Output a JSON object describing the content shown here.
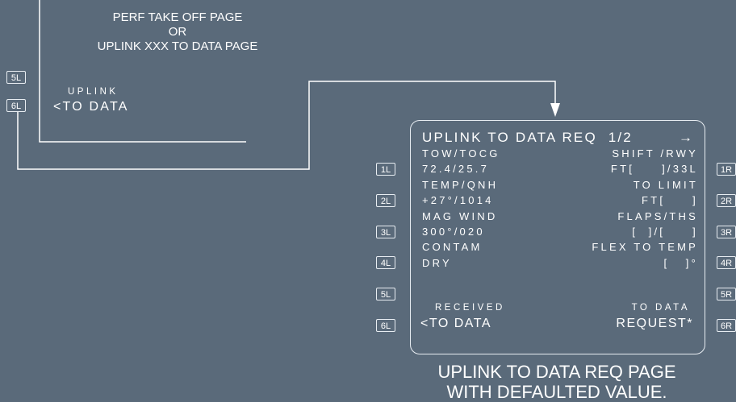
{
  "caption_top": {
    "line1": "PERF TAKE OFF PAGE",
    "line2": "OR",
    "line3": "UPLINK XXX TO DATA PAGE"
  },
  "left_panel": {
    "keys": {
      "l5": "5L",
      "l6": "6L"
    },
    "uplink_label": "UPLINK",
    "to_data_label": "<TO DATA"
  },
  "mcdu": {
    "title": "UPLINK TO DATA REQ  1/2",
    "arrow": "→",
    "left_keys": [
      "1L",
      "2L",
      "3L",
      "4L",
      "5L",
      "6L"
    ],
    "right_keys": [
      "1R",
      "2R",
      "3R",
      "4R",
      "5R",
      "6R"
    ],
    "lines": {
      "tow_tocg_label": "TOW/TOCG",
      "shift_rwy_label": "SHIFT /RWY",
      "tow_tocg_value": "72.4/25.7",
      "shift_rwy_value": "FT[     ]/33L",
      "temp_qnh_label": "TEMP/QNH",
      "to_limit_label": "TO LIMIT",
      "temp_qnh_value": "+27°/1014",
      "to_limit_value": "FT[     ]",
      "mag_wind_label": "MAG WIND",
      "flaps_ths_label": "FLAPS/THS",
      "mag_wind_value": "300°/020",
      "flaps_ths_value": "[  ]/[     ]",
      "contam_label": "CONTAM",
      "flex_temp_label": "FLEX TO TEMP",
      "contam_value": "DRY",
      "flex_temp_value": "[   ]°",
      "received_label": "RECEIVED",
      "received_value": "<TO DATA",
      "to_data_label": "TO DATA",
      "request_value": "REQUEST*"
    }
  },
  "caption_bottom": {
    "line1": "UPLINK TO DATA REQ PAGE",
    "line2": "WITH DEFAULTED VALUE."
  }
}
